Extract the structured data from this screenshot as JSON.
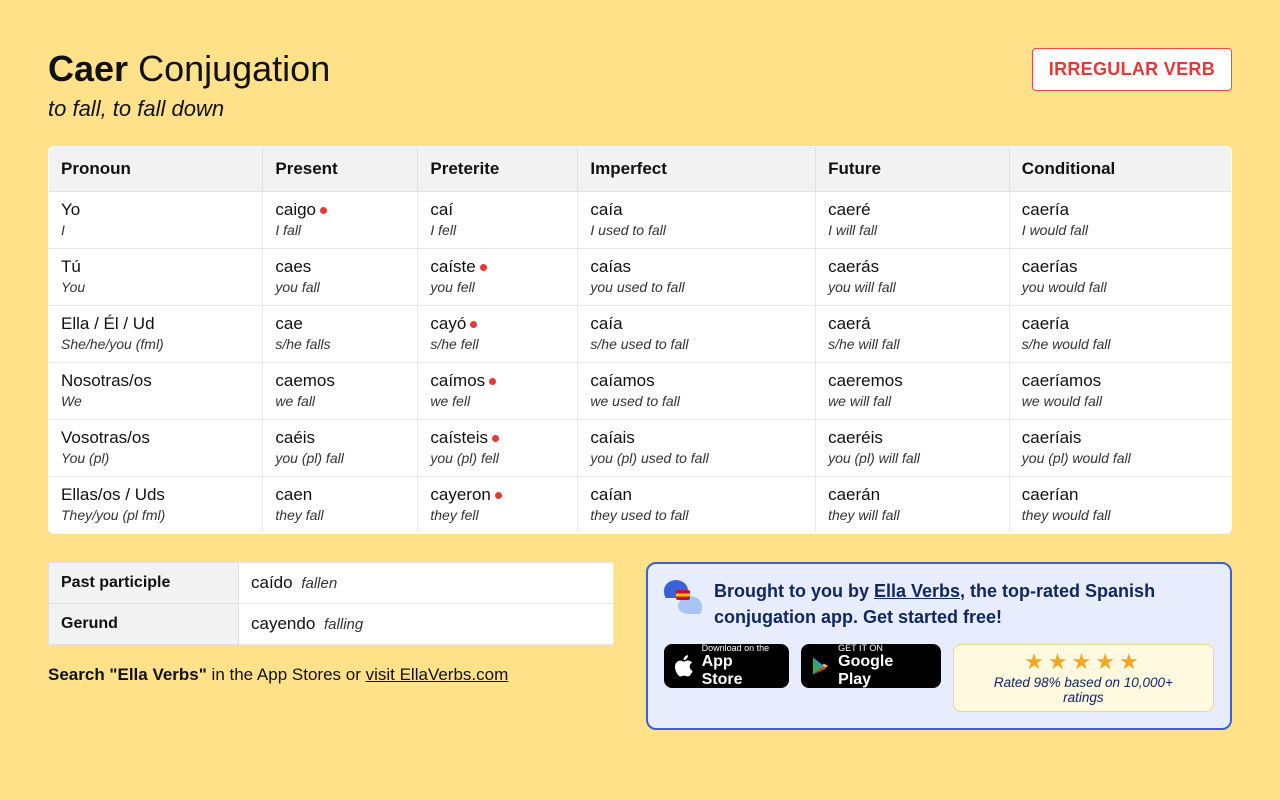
{
  "header": {
    "verb": "Caer",
    "title_rest": "Conjugation",
    "subtitle": "to fall, to fall down",
    "badge": "IRREGULAR VERB"
  },
  "table": {
    "columns": [
      "Pronoun",
      "Present",
      "Preterite",
      "Imperfect",
      "Future",
      "Conditional"
    ],
    "rows": [
      {
        "pronoun": "Yo",
        "pronoun_gloss": "I",
        "cells": [
          {
            "form": "caigo",
            "gloss": "I fall",
            "irregular": true
          },
          {
            "form": "caí",
            "gloss": "I fell",
            "irregular": false
          },
          {
            "form": "caía",
            "gloss": "I used to fall",
            "irregular": false
          },
          {
            "form": "caeré",
            "gloss": "I will fall",
            "irregular": false
          },
          {
            "form": "caería",
            "gloss": "I would fall",
            "irregular": false
          }
        ]
      },
      {
        "pronoun": "Tú",
        "pronoun_gloss": "You",
        "cells": [
          {
            "form": "caes",
            "gloss": "you fall",
            "irregular": false
          },
          {
            "form": "caíste",
            "gloss": "you fell",
            "irregular": true
          },
          {
            "form": "caías",
            "gloss": "you used to fall",
            "irregular": false
          },
          {
            "form": "caerás",
            "gloss": "you will fall",
            "irregular": false
          },
          {
            "form": "caerías",
            "gloss": "you would fall",
            "irregular": false
          }
        ]
      },
      {
        "pronoun": "Ella / Él / Ud",
        "pronoun_gloss": "She/he/you (fml)",
        "cells": [
          {
            "form": "cae",
            "gloss": "s/he falls",
            "irregular": false
          },
          {
            "form": "cayó",
            "gloss": "s/he fell",
            "irregular": true
          },
          {
            "form": "caía",
            "gloss": "s/he used to fall",
            "irregular": false
          },
          {
            "form": "caerá",
            "gloss": "s/he will fall",
            "irregular": false
          },
          {
            "form": "caería",
            "gloss": "s/he would fall",
            "irregular": false
          }
        ]
      },
      {
        "pronoun": "Nosotras/os",
        "pronoun_gloss": "We",
        "cells": [
          {
            "form": "caemos",
            "gloss": "we fall",
            "irregular": false
          },
          {
            "form": "caímos",
            "gloss": "we fell",
            "irregular": true
          },
          {
            "form": "caíamos",
            "gloss": "we used to fall",
            "irregular": false
          },
          {
            "form": "caeremos",
            "gloss": "we will fall",
            "irregular": false
          },
          {
            "form": "caeríamos",
            "gloss": "we would fall",
            "irregular": false
          }
        ]
      },
      {
        "pronoun": "Vosotras/os",
        "pronoun_gloss": "You (pl)",
        "cells": [
          {
            "form": "caéis",
            "gloss": "you (pl) fall",
            "irregular": false
          },
          {
            "form": "caísteis",
            "gloss": "you (pl) fell",
            "irregular": true
          },
          {
            "form": "caíais",
            "gloss": "you (pl) used to fall",
            "irregular": false
          },
          {
            "form": "caeréis",
            "gloss": "you (pl) will fall",
            "irregular": false
          },
          {
            "form": "caeríais",
            "gloss": "you (pl) would fall",
            "irregular": false
          }
        ]
      },
      {
        "pronoun": "Ellas/os / Uds",
        "pronoun_gloss": "They/you (pl fml)",
        "cells": [
          {
            "form": "caen",
            "gloss": "they fall",
            "irregular": false
          },
          {
            "form": "cayeron",
            "gloss": "they fell",
            "irregular": true
          },
          {
            "form": "caían",
            "gloss": "they used to fall",
            "irregular": false
          },
          {
            "form": "caerán",
            "gloss": "they will fall",
            "irregular": false
          },
          {
            "form": "caerían",
            "gloss": "they would fall",
            "irregular": false
          }
        ]
      }
    ]
  },
  "participles": {
    "past_label": "Past participle",
    "past_form": "caído",
    "past_gloss": "fallen",
    "gerund_label": "Gerund",
    "gerund_form": "cayendo",
    "gerund_gloss": "falling"
  },
  "search_line": {
    "bold": "Search \"Ella Verbs\"",
    "rest": " in the App Stores or ",
    "link": "visit EllaVerbs.com"
  },
  "promo": {
    "prefix": "Brought to you by ",
    "link": "Ella Verbs",
    "suffix": ", the top-rated Spanish conjugation app. Get started free!",
    "appstore_small": "Download on the",
    "appstore_big": "App Store",
    "play_small": "GET IT ON",
    "play_big": "Google Play",
    "stars": "★★★★★",
    "rating_text": "Rated 98% based on 10,000+ ratings"
  }
}
